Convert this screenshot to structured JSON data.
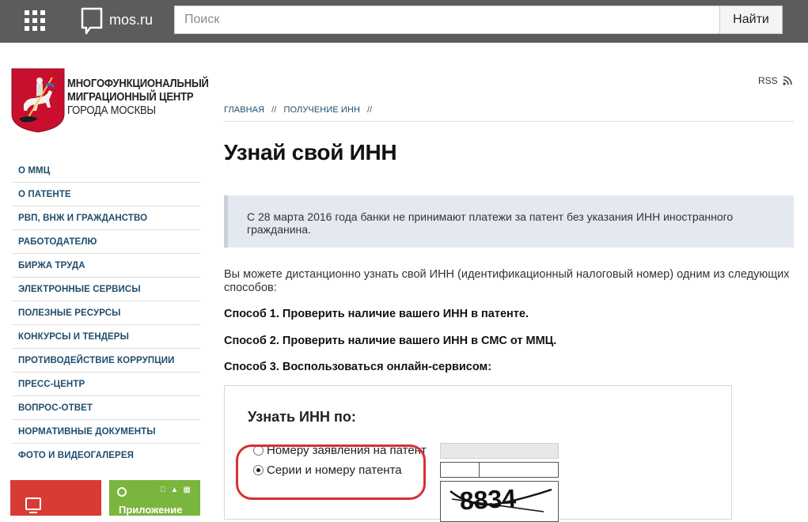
{
  "header": {
    "site_name": "mos.ru",
    "search_placeholder": "Поиск",
    "search_button": "Найти"
  },
  "brand": {
    "line1": "МНОГОФУНКЦИОНАЛЬНЫЙ",
    "line2": "МИГРАЦИОННЫЙ ЦЕНТР",
    "line3": "ГОРОДА МОСКВЫ"
  },
  "sidebar": {
    "items": [
      {
        "label": "О ММЦ"
      },
      {
        "label": "О ПАТЕНТЕ"
      },
      {
        "label": "РВП, ВНЖ И ГРАЖДАНСТВО"
      },
      {
        "label": "РАБОТОДАТЕЛЮ"
      },
      {
        "label": "БИРЖА ТРУДА"
      },
      {
        "label": "ЭЛЕКТРОННЫЕ СЕРВИСЫ"
      },
      {
        "label": "ПОЛЕЗНЫЕ РЕСУРСЫ"
      },
      {
        "label": "КОНКУРСЫ И ТЕНДЕРЫ"
      },
      {
        "label": "ПРОТИВОДЕЙСТВИЕ КОРРУПЦИИ"
      },
      {
        "label": "ПРЕСС-ЦЕНТР"
      },
      {
        "label": "ВОПРОС-ОТВЕТ"
      },
      {
        "label": "НОРМАТИВНЫЕ ДОКУМЕНТЫ"
      },
      {
        "label": "ФОТО И ВИДЕОГАЛЕРЕЯ"
      }
    ],
    "promo_app_label": "Приложение"
  },
  "main": {
    "rss": "RSS",
    "breadcrumb": [
      "ГЛАВНАЯ",
      "ПОЛУЧЕНИЕ ИНН"
    ],
    "breadcrumb_sep": "//",
    "title": "Узнай свой ИНН",
    "notice": "С 28 марта 2016 года банки не принимают платежи за патент без указания ИНН иностранного гражданина.",
    "intro": "Вы можете дистанционно узнать свой ИНН (идентификационный налоговый номер) одним из следующих способов:",
    "methods": [
      "Способ 1. Проверить наличие вашего ИНН в патенте.",
      "Способ 2. Проверить наличие вашего ИНН в СМС от ММЦ.",
      "Способ 3. Воспользоваться онлайн-сервисом:"
    ],
    "service": {
      "title": "Узнать ИНН по:",
      "options": [
        {
          "label": "Номеру заявления на патент",
          "checked": false
        },
        {
          "label": "Серии и номеру патента",
          "checked": true
        }
      ],
      "captcha_text": "8834"
    }
  },
  "colors": {
    "topbar": "#5c5c5c",
    "nav_link": "#1f4d6d",
    "notice_bg": "#e4e9f0",
    "highlight": "#d63033",
    "promo_red": "#d83b33",
    "promo_green": "#7ab53d"
  }
}
